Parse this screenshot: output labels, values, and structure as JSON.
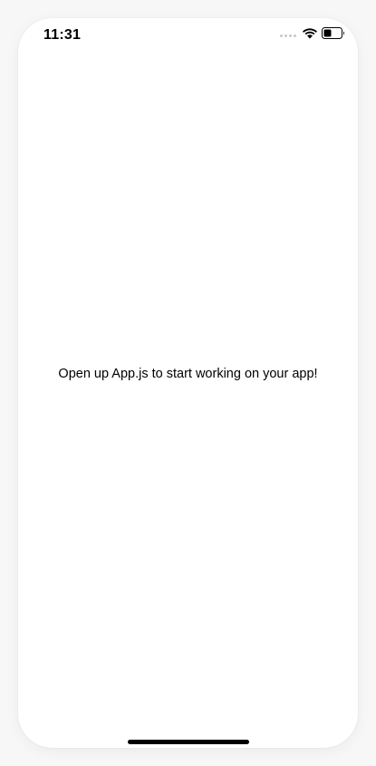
{
  "status_bar": {
    "time": "11:31",
    "icons": [
      "cellular-signal-icon",
      "wifi-icon",
      "battery-icon"
    ]
  },
  "main": {
    "message": "Open up App.js to start working on your app!"
  },
  "colors": {
    "background": "#ffffff",
    "text": "#000000",
    "home_indicator": "#000000"
  }
}
